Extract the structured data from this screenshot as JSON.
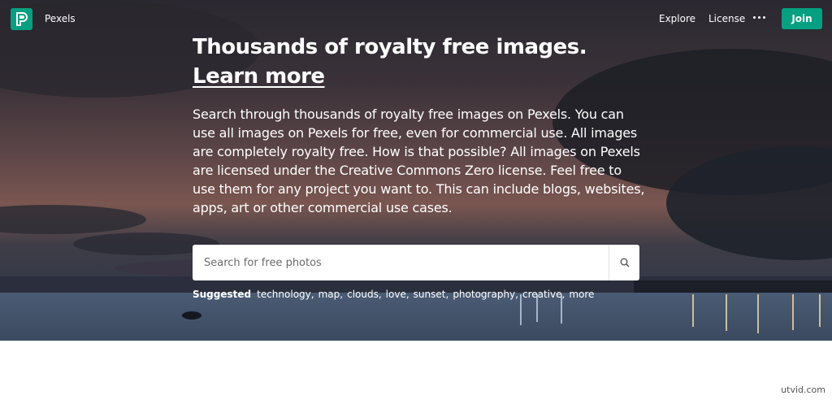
{
  "header": {
    "brand": "Pexels",
    "nav": {
      "explore": "Explore",
      "license": "License"
    },
    "join_label": "Join"
  },
  "hero": {
    "headline": "Thousands of royalty free images.",
    "headline_link": "Learn more",
    "description": "Search through thousands of royalty free images on Pexels. You can use all images on Pexels for free, even for commercial use. All images are completely royalty free. How is that possible? All images on Pexels are licensed under the Creative Commons Zero license. Feel free to use them for any project you want to. This can include blogs, websites, apps, art or other commercial use cases."
  },
  "search": {
    "placeholder": "Search for free photos",
    "icon": "search-icon"
  },
  "suggested": {
    "label": "Suggested",
    "tags": [
      "technology",
      "map",
      "clouds",
      "love",
      "sunset",
      "photography",
      "creative",
      "more"
    ]
  },
  "watermark": "utvid.com",
  "colors": {
    "accent": "#05a081"
  }
}
